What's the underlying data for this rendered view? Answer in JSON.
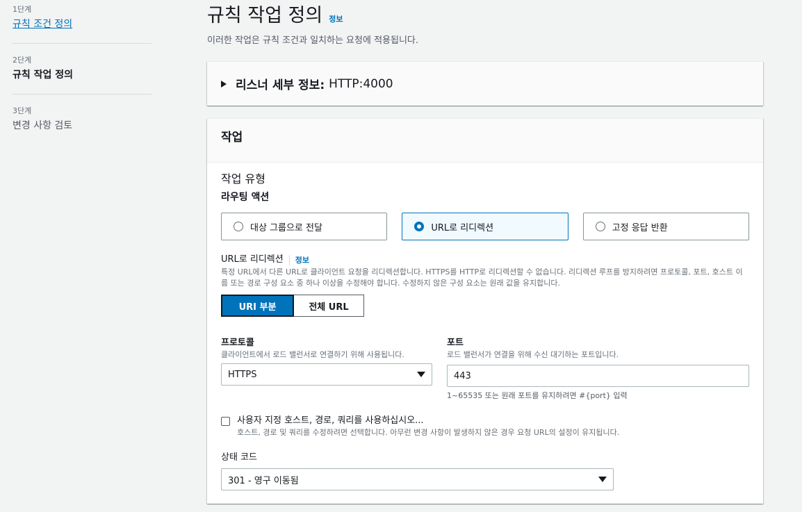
{
  "steps": [
    {
      "num": "1단계",
      "title": "규칙 조건 정의"
    },
    {
      "num": "2단계",
      "title": "규칙 작업 정의"
    },
    {
      "num": "3단계",
      "title": "변경 사항 검토"
    }
  ],
  "header": {
    "title": "규칙 작업 정의",
    "info": "정보",
    "description": "이러한 작업은 규칙 조건과 일치하는 요청에 적용됩니다."
  },
  "listener": {
    "label": "리스너 세부 정보:",
    "value": "HTTP:4000"
  },
  "action": {
    "heading": "작업",
    "type_label": "작업 유형",
    "routing_label": "라우팅 액션",
    "tiles": [
      {
        "label": "대상 그룹으로 전달",
        "selected": false
      },
      {
        "label": "URL로 리디렉션",
        "selected": true
      },
      {
        "label": "고정 응답 반환",
        "selected": false
      }
    ],
    "redirect": {
      "label": "URL로 리디렉션",
      "info": "정보",
      "description": "특정 URL에서 다른 URL로 클라이언트 요청을 리디렉션합니다. HTTPS를 HTTP로 리디렉션할 수 없습니다. 리디렉션 루프를 방지하려면 프로토콜, 포트, 호스트 이름 또는 경로 구성 요소 중 하나 이상을 수정해야 합니다. 수정하지 않은 구성 요소는 원래 값을 유지합니다.",
      "segments": [
        "URI 부분",
        "전체 URL"
      ],
      "active_segment": "URI 부분"
    },
    "protocol": {
      "label": "프로토콜",
      "description": "클라이언트에서 로드 밸런서로 연결하기 위해 사용됩니다.",
      "value": "HTTPS"
    },
    "port": {
      "label": "포트",
      "description": "로드 밸런서가 연결을 위해 수신 대기하는 포트입니다.",
      "value": "443",
      "hint": "1~65535 또는 원래 포트를 유지하려면 #{port} 입력"
    },
    "custom": {
      "label": "사용자 지정 호스트, 경로, 쿼리를 사용하십시오...",
      "description": "호스트, 경로 및 쿼리를 수정하려면 선택합니다. 아무런 변경 사항이 발생하지 않은 경우 요청 URL의 설정이 유지됩니다.",
      "checked": false
    },
    "status_code": {
      "label": "상태 코드",
      "value": "301 - 영구 이동됨"
    }
  },
  "colors": {
    "accent": "#0073bb",
    "selected_tile_bg": "#f1faff",
    "page_bg": "#f2f3f3"
  }
}
